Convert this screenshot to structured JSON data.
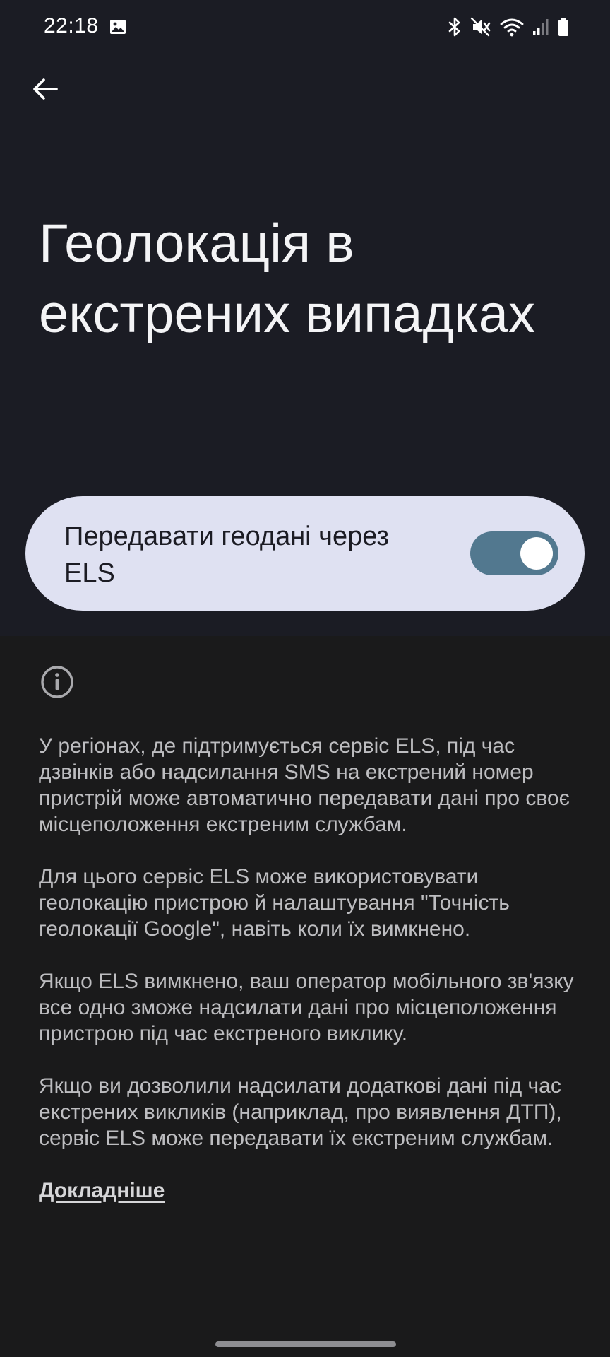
{
  "status_bar": {
    "time": "22:18",
    "icons": [
      "gallery-icon",
      "bluetooth-icon",
      "mute-icon",
      "wifi-icon",
      "signal-icon",
      "battery-icon"
    ]
  },
  "header": {
    "back_icon": "arrow-back-icon"
  },
  "title": "Геолокація в екстрених випадках",
  "toggle": {
    "label": "Передавати геодані через ELS",
    "state": "on"
  },
  "info": {
    "icon": "info-icon",
    "paragraphs": [
      "У регіонах, де підтримується сервіс ELS, під час дзвінків або надсилання SMS на екстрений номер пристрій може автоматично передавати дані про своє місцеположення екстреним службам.",
      "Для цього сервіс ELS може використовувати геолокацію пристрою й налаштування \"Точність геолокації Google\", навіть коли їх вимкнено.",
      "Якщо ELS вимкнено, ваш оператор мобільного зв'язку все одно зможе надсилати дані про місцеположення пристрою під час екстреного виклику.",
      "Якщо ви дозволили надсилати додаткові дані під час екстрених викликів (наприклад, про виявлення ДТП), сервіс ELS може передавати їх екстреним службам."
    ],
    "learn_more": "Докладніше"
  },
  "colors": {
    "top_background": "#1b1c24",
    "bottom_background": "#1a1a1b",
    "card_background": "#dfe1f2",
    "switch_track": "#52788f"
  }
}
